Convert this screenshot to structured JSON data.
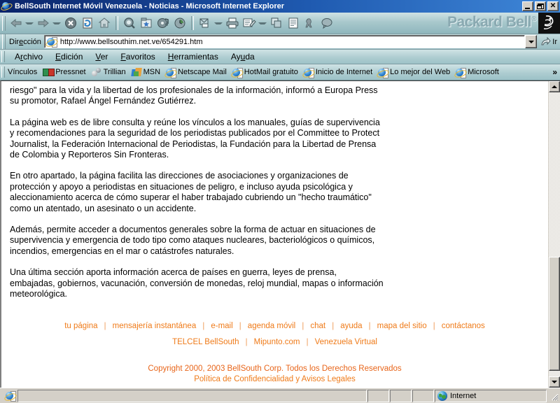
{
  "window": {
    "title": "BellSouth Internet Móvil Venezuela - Noticias - Microsoft Internet Explorer",
    "icon": "ie-document-icon",
    "minimize_label": "_",
    "maximize_label": "□",
    "close_label": "✕"
  },
  "toolbar": {
    "buttons": [
      {
        "name": "back",
        "icon": "arrow-left-icon",
        "has_caret": true
      },
      {
        "name": "forward",
        "icon": "arrow-right-icon",
        "has_caret": true
      },
      {
        "name": "stop",
        "icon": "stop-icon",
        "has_caret": false
      },
      {
        "name": "refresh",
        "icon": "refresh-icon",
        "has_caret": false
      },
      {
        "name": "home",
        "icon": "home-icon",
        "has_caret": false
      },
      {
        "name": "search",
        "icon": "search-icon",
        "has_caret": false
      },
      {
        "name": "favorites",
        "icon": "favorites-star-icon",
        "has_caret": false
      },
      {
        "name": "media",
        "icon": "media-note-icon",
        "has_caret": false
      },
      {
        "name": "history",
        "icon": "history-clock-icon",
        "has_caret": false
      },
      {
        "name": "mail",
        "icon": "mail-icon",
        "has_caret": true
      },
      {
        "name": "print",
        "icon": "printer-icon",
        "has_caret": false
      },
      {
        "name": "edit",
        "icon": "edit-pencil-icon",
        "has_caret": true
      },
      {
        "name": "discuss",
        "icon": "copy-pages-icon",
        "has_caret": false
      },
      {
        "name": "messenger",
        "icon": "document-lines-icon",
        "has_caret": false
      },
      {
        "name": "realplayer",
        "icon": "kangaroo-icon",
        "has_caret": false
      },
      {
        "name": "comment",
        "icon": "speech-balloon-icon",
        "has_caret": false
      }
    ],
    "brand": "Packard Bell",
    "brand_mark": "®"
  },
  "address_bar": {
    "label_pre": "Dir",
    "label_accel": "e",
    "label_post": "cción",
    "url": "http://www.bellsouthim.net.ve/654291.htm",
    "go_label": "Ir",
    "dropdown_icon": "chevron-down-icon",
    "go_icon": "go-arrow-icon",
    "page_icon": "ie-page-icon"
  },
  "menu": {
    "items": [
      {
        "pre": "A",
        "accel": "r",
        "post": "chivo",
        "full": "Archivo"
      },
      {
        "pre": "",
        "accel": "E",
        "post": "dición",
        "full": "Edición"
      },
      {
        "pre": "",
        "accel": "V",
        "post": "er",
        "full": "Ver"
      },
      {
        "pre": "",
        "accel": "F",
        "post": "avoritos",
        "full": "Favoritos"
      },
      {
        "pre": "",
        "accel": "H",
        "post": "erramientas",
        "full": "Herramientas"
      },
      {
        "pre": "Ay",
        "accel": "u",
        "post": "da",
        "full": "Ayuda"
      }
    ]
  },
  "links_bar": {
    "title": "Vínculos",
    "overflow": "»",
    "items": [
      {
        "label": "Pressnet",
        "icon": "pressnet-icon"
      },
      {
        "label": "Trillian",
        "icon": "trillian-icon"
      },
      {
        "label": "MSN",
        "icon": "msn-butterfly-icon"
      },
      {
        "label": "Netscape Mail",
        "icon": "ie-page-icon"
      },
      {
        "label": "HotMail gratuito",
        "icon": "ie-page-icon"
      },
      {
        "label": "Inicio de Internet",
        "icon": "ie-page-icon"
      },
      {
        "label": "Lo mejor del Web",
        "icon": "ie-page-icon"
      },
      {
        "label": "Microsoft",
        "icon": "ie-page-icon"
      }
    ]
  },
  "page": {
    "paragraphs": [
      "riesgo\" para la vida y la libertad de los profesionales de la información, informó a Europa Press su promotor, Rafael Ángel Fernández Gutiérrez.",
      "La página web es de libre consulta y reúne los vínculos a los manuales, guías de supervivencia y recomendaciones para la seguridad de los periodistas publicados por el Committee to Protect Journalist, la Federación Internacional de Periodistas, la Fundación para la Libertad de Prensa de Colombia y Reporteros Sin Fronteras.",
      "En otro apartado, la página facilita las direcciones de asociaciones y organizaciones de protección y apoyo a periodistas en situaciones de peligro, e incluso ayuda psicológica y aleccionamiento acerca de cómo superar el haber trabajado cubriendo un \"hecho traumático\" como un atentado, un asesinato o un accidente.",
      "Además, permite acceder a documentos generales sobre la forma de actuar en situaciones de supervivencia y emergencia de todo tipo como ataques nucleares, bacteriológicos o químicos, incendios, emergencias en el mar o catástrofes naturales.",
      "Una última sección aporta información acerca de países en guerra, leyes de prensa, embajadas, gobiernos, vacunación, conversión de monedas, reloj mundial, mapas o información meteorológica."
    ],
    "footer_rows": [
      [
        "tu página",
        "mensajería instantánea",
        "e-mail",
        "agenda móvil",
        "chat",
        "ayuda",
        "mapa del sitio",
        "contáctanos"
      ],
      [
        "TELCEL BellSouth",
        "Mipunto.com",
        "Venezuela Virtual"
      ]
    ],
    "footer_separator": "|",
    "copyright_line1": "Copyright 2000, 2003 BellSouth Corp. Todos los Derechos Reservados",
    "copyright_line2": "Política de Confidencialidad y Avisos Legales",
    "link_color": "#ef7a18",
    "copyright_color": "#e8651a"
  },
  "scrollbar": {
    "up_icon": "scroll-up-arrow-icon",
    "down_icon": "scroll-down-arrow-icon",
    "thumb_top_percent": 58,
    "thumb_height_percent": 40
  },
  "status_bar": {
    "message": "",
    "zone": "Internet",
    "zone_icon": "internet-globe-icon",
    "page_icon": "ie-page-icon"
  }
}
